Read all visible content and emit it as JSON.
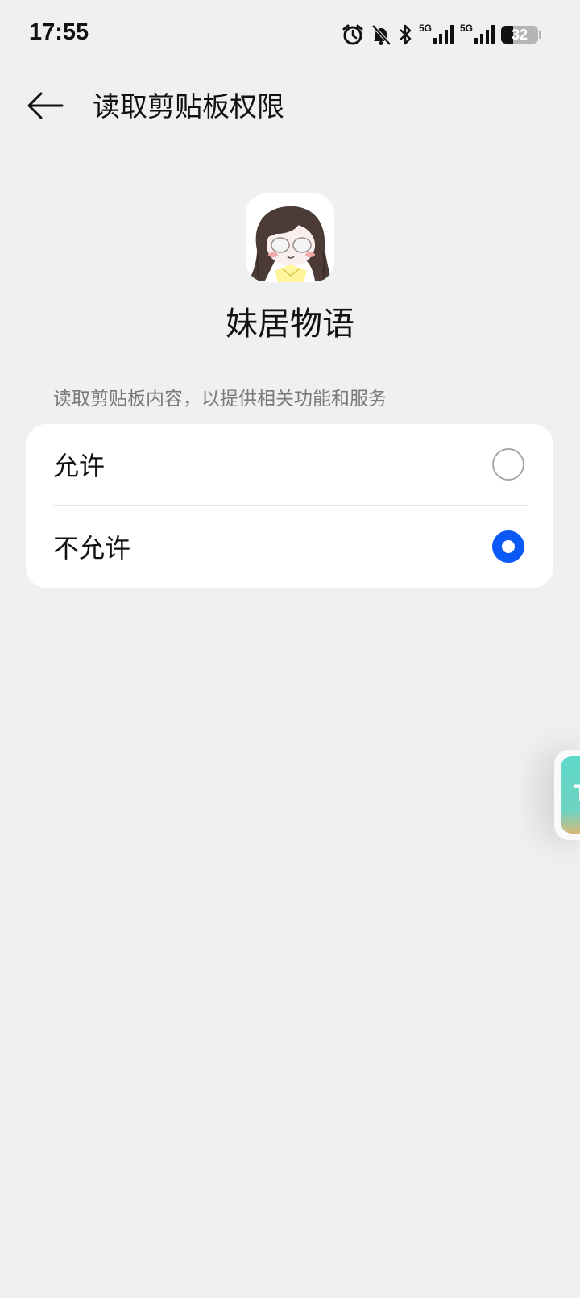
{
  "status_bar": {
    "time": "17:55",
    "icons": [
      "alarm-icon",
      "bell-off-icon",
      "bluetooth-icon",
      "signal-5g-icon",
      "signal-5g-icon"
    ],
    "network_label_1": "5G",
    "network_label_2": "5G",
    "battery_level": "32",
    "battery_fraction": 0.32
  },
  "header": {
    "title": "读取剪贴板权限",
    "back_icon": "arrow-left-icon"
  },
  "app": {
    "name": "妹居物语",
    "icon": "app-avatar-icon"
  },
  "permission": {
    "description": "读取剪贴板内容，以提供相关功能和服务",
    "options": [
      {
        "label": "允许",
        "selected": false
      },
      {
        "label": "不允许",
        "selected": true
      }
    ]
  },
  "floating_bubble": {
    "glyph": "T"
  },
  "colors": {
    "accent": "#0a59f7",
    "background": "#eff0f2",
    "card": "#ffffff"
  }
}
